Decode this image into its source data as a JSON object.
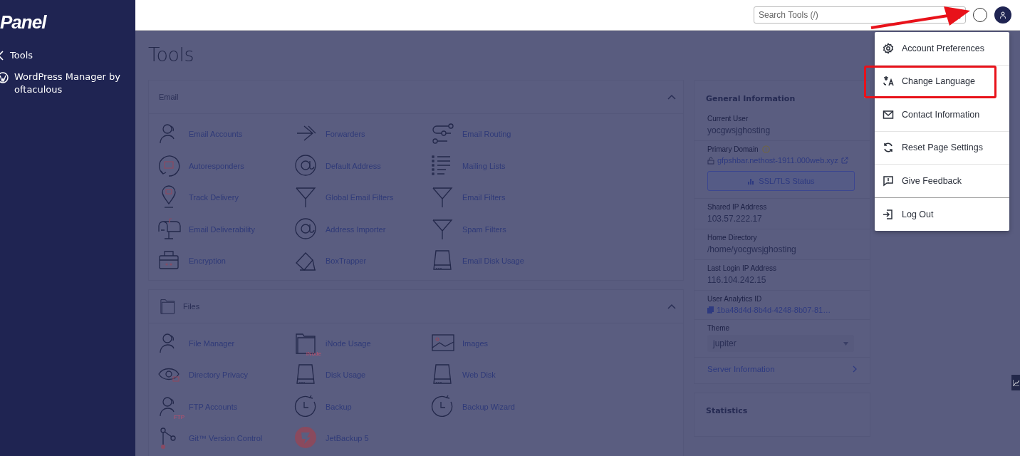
{
  "sidebar": {
    "logo": "Panel",
    "items": [
      {
        "label": "Tools",
        "kind": "back"
      },
      {
        "label": "WordPress Manager by oftaculous",
        "kind": "wordpress"
      }
    ]
  },
  "header": {
    "search": {
      "placeholder": "Search Tools (/)"
    }
  },
  "page_title": "Tools",
  "sections": [
    {
      "title": "Email",
      "kind": "mail",
      "expanded": true,
      "items": [
        {
          "label": "Email Accounts",
          "kind": "person"
        },
        {
          "label": "Forwarders",
          "kind": "arrows"
        },
        {
          "label": "Email Routing",
          "kind": "routing"
        },
        {
          "label": "Autoresponders",
          "kind": "cycle"
        },
        {
          "label": "Default Address",
          "kind": "at"
        },
        {
          "label": "Mailing Lists",
          "kind": "list"
        },
        {
          "label": "Track Delivery",
          "kind": "pin"
        },
        {
          "label": "Global Email Filters",
          "kind": "funnel"
        },
        {
          "label": "Email Filters",
          "kind": "funnel"
        },
        {
          "label": "Email Deliverability",
          "kind": "mailbox"
        },
        {
          "label": "Address Importer",
          "kind": "at"
        },
        {
          "label": "Spam Filters",
          "kind": "funnel"
        },
        {
          "label": "Encryption",
          "kind": "case"
        },
        {
          "label": "BoxTrapper",
          "kind": "diamond"
        },
        {
          "label": "Email Disk Usage",
          "kind": "drive"
        }
      ]
    },
    {
      "title": "Files",
      "kind": "folder",
      "expanded": true,
      "items": [
        {
          "label": "File Manager",
          "kind": "person"
        },
        {
          "label": "iNode Usage",
          "kind": "folder",
          "icon_text": "iNode"
        },
        {
          "label": "Images",
          "kind": "image"
        },
        {
          "label": "Directory Privacy",
          "kind": "eye"
        },
        {
          "label": "Disk Usage",
          "kind": "drive"
        },
        {
          "label": "Web Disk",
          "kind": "drive"
        },
        {
          "label": "FTP Accounts",
          "kind": "person",
          "icon_text": "FTP"
        },
        {
          "label": "Backup",
          "kind": "clock"
        },
        {
          "label": "Backup Wizard",
          "kind": "clock"
        },
        {
          "label": "Git™ Version Control",
          "kind": "branch"
        },
        {
          "label": "JetBackup 5",
          "kind": "jet"
        }
      ]
    }
  ],
  "general_information": {
    "title": "General Information",
    "rows": [
      {
        "label": "Current User",
        "value": "yocgwsjghosting",
        "kind": "text"
      },
      {
        "label": "Primary Domain",
        "value": "gfpshbar.nethost-1911.000web.xyz",
        "kind": "domain",
        "button": "SSL/TLS Status"
      },
      {
        "label": "Shared IP Address",
        "value": "103.57.222.17",
        "kind": "text"
      },
      {
        "label": "Home Directory",
        "value": "/home/yocgwsjghosting",
        "kind": "text"
      },
      {
        "label": "Last Login IP Address",
        "value": "116.104.242.15",
        "kind": "text"
      },
      {
        "label": "User Analytics ID",
        "value": "1ba48d4d-8b4d-4248-8b07-81…",
        "kind": "copy"
      },
      {
        "label": "Theme",
        "value": "jupiter",
        "kind": "select"
      }
    ],
    "link": "Server Information"
  },
  "statistics": {
    "title": "Statistics"
  },
  "user_menu": {
    "items": [
      {
        "label": "Account Preferences",
        "kind": "gear",
        "highlighted": false
      },
      {
        "label": "Change Language",
        "kind": "language",
        "highlighted": true
      },
      {
        "label": "Contact Information",
        "kind": "mail",
        "highlighted": false
      },
      {
        "label": "Reset Page Settings",
        "kind": "reset",
        "highlighted": false
      },
      {
        "label": "Give Feedback",
        "kind": "feedback",
        "highlighted": false
      },
      {
        "label": "Log Out",
        "kind": "logout",
        "highlighted": false
      }
    ]
  }
}
